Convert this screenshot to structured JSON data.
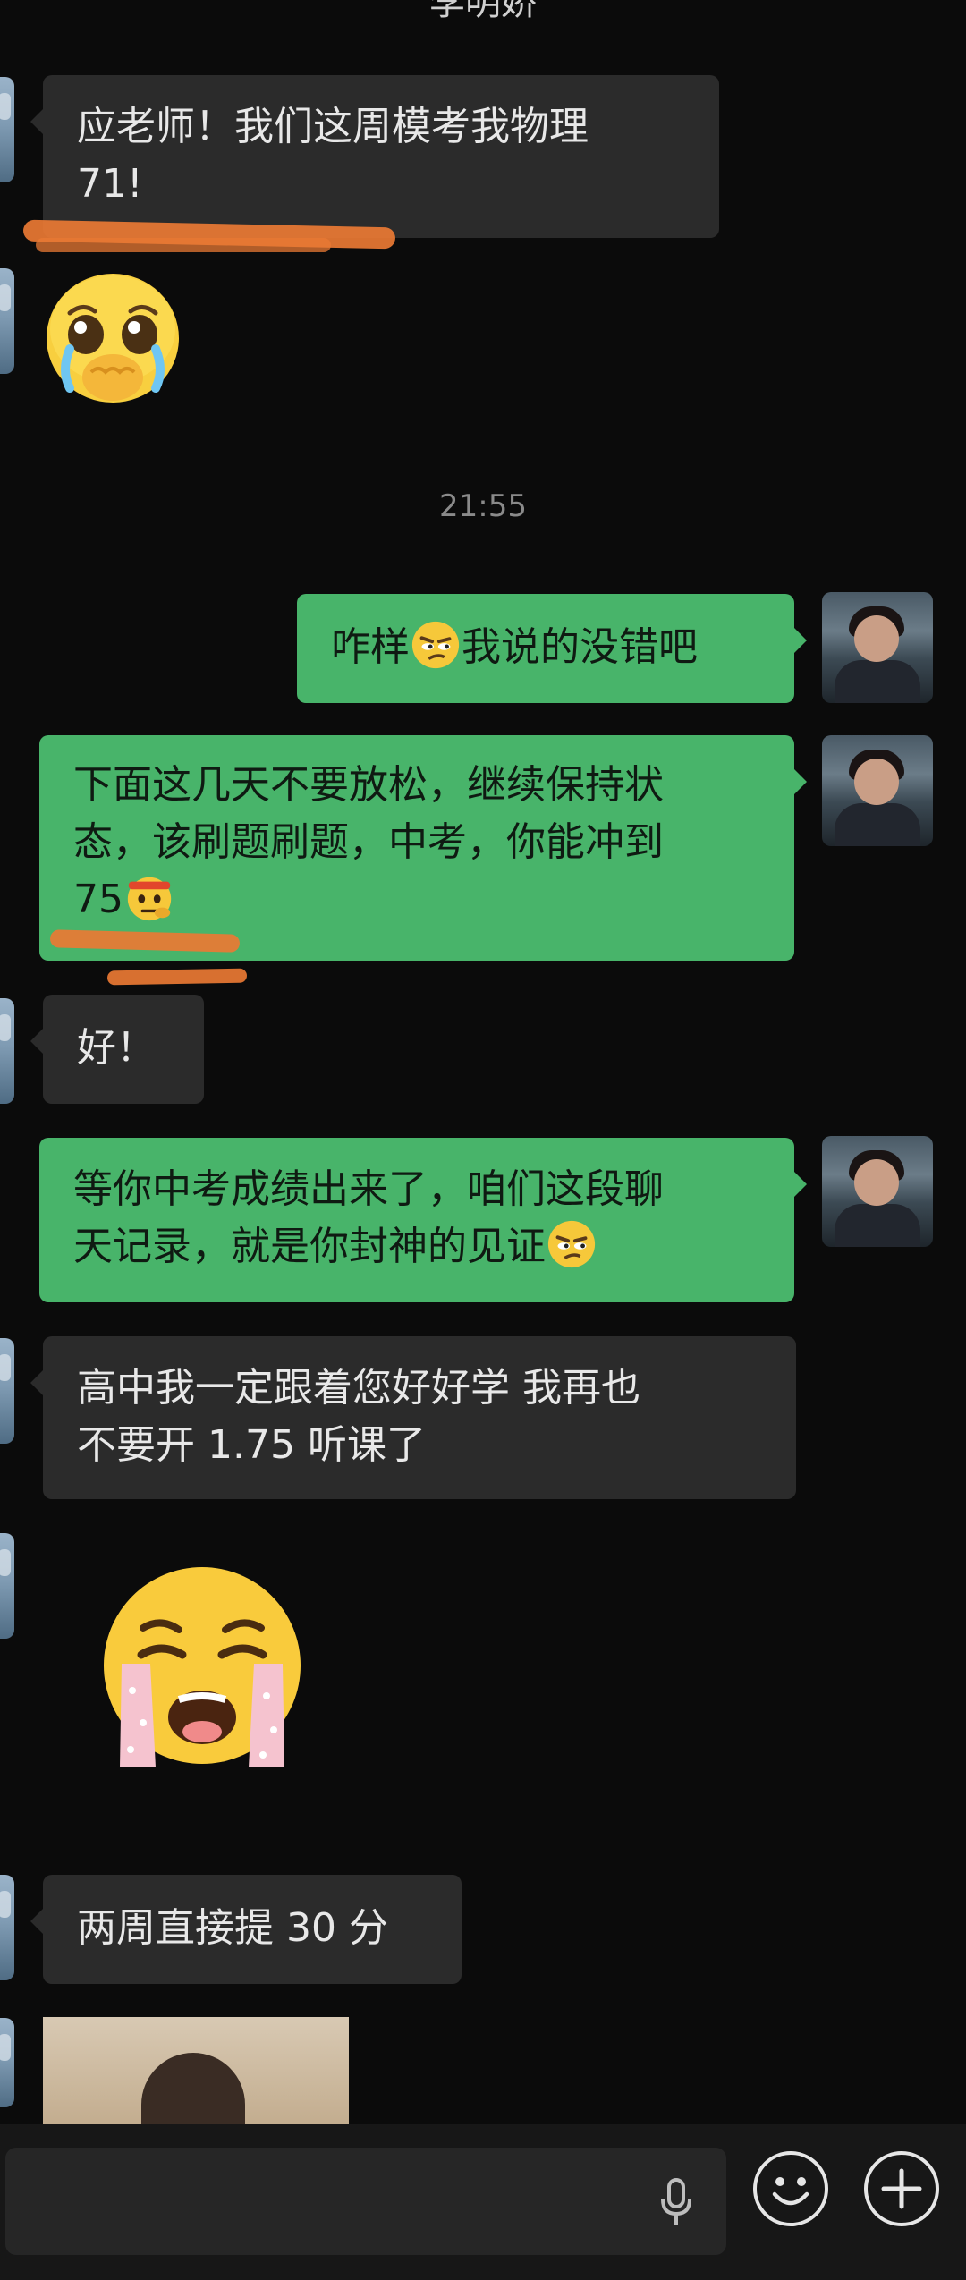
{
  "header": {
    "title": "李明娇"
  },
  "messages": {
    "m1": {
      "line1": "应老师！我们这周模考我物理",
      "line2": "71!"
    },
    "timestamp": "21:55",
    "m2": {
      "text_a": "咋样",
      "text_b": "我说的没错吧"
    },
    "m3": {
      "line1": "下面这几天不要放松，继续保持状",
      "line2": "态，该刷题刷题，中考，你能冲到",
      "line3": "75"
    },
    "m4": {
      "text": "好！"
    },
    "m5": {
      "line1": "等你中考成绩出来了，咱们这段聊",
      "line2": "天记录，就是你封神的见证"
    },
    "m6": {
      "line1": "高中我一定跟着您好好学 我再也",
      "line2": "不要开 1.75 听课了"
    },
    "m7": {
      "text": "两周直接提 30 分"
    }
  },
  "icons": {
    "sticker_1": "teary-pleading-face-sticker",
    "sticker_2": "loudly-crying-face-sticker",
    "emoji_smirk": "skeptical-smirk-emoji",
    "emoji_think": "thinking-headband-emoji",
    "mic": "microphone-icon",
    "emoji_button": "smiley-icon",
    "add_button": "plus-icon"
  },
  "colors": {
    "background": "#0b0b0b",
    "gray_bubble": "#2b2b2b",
    "green_bubble": "#48b46a",
    "highlight_underline": "#ea7a34"
  }
}
